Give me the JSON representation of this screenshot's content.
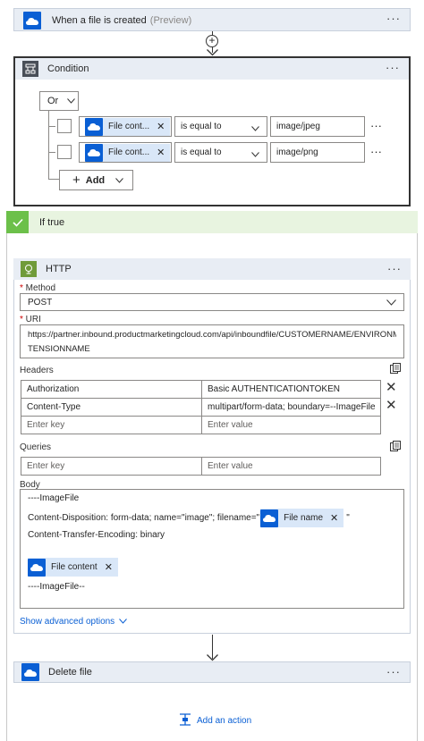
{
  "trigger": {
    "title": "When a file is created",
    "preview": "(Preview)"
  },
  "condition": {
    "title": "Condition",
    "operator": "Or",
    "rows": [
      {
        "token": "File cont...",
        "op": "is equal to",
        "value": "image/jpeg"
      },
      {
        "token": "File cont...",
        "op": "is equal to",
        "value": "image/png"
      }
    ],
    "add_label": "Add"
  },
  "iftrue": {
    "title": "If true"
  },
  "http": {
    "title": "HTTP",
    "method_label": "Method",
    "method_value": "POST",
    "uri_label": "URI",
    "uri_line1": "https://partner.inbound.productmarketingcloud.com/api/inboundfile/CUSTOMERNAME/ENVIRONMENT/EX",
    "uri_line2": "TENSIONNAME",
    "headers_label": "Headers",
    "headers": [
      {
        "key": "Authorization",
        "value": "Basic AUTHENTICATIONTOKEN"
      },
      {
        "key": "Content-Type",
        "value": "multipart/form-data; boundary=--ImageFile"
      }
    ],
    "key_placeholder": "Enter key",
    "value_placeholder": "Enter value",
    "queries_label": "Queries",
    "body_label": "Body",
    "body_line1": "----ImageFile",
    "body_line2a": "Content-Disposition: form-data; name=\"image\"; filename=\"",
    "body_token1": "File name",
    "body_line2b": "\"",
    "body_line3": "Content-Transfer-Encoding: binary",
    "body_token2": "File content",
    "body_line4": "----ImageFile--",
    "advanced": "Show advanced options"
  },
  "delete": {
    "title": "Delete file"
  },
  "add_action": "Add an action",
  "colors": {
    "accent": "#0a5fd4",
    "success": "#6cc04a",
    "header_bg": "#e8edf4"
  }
}
